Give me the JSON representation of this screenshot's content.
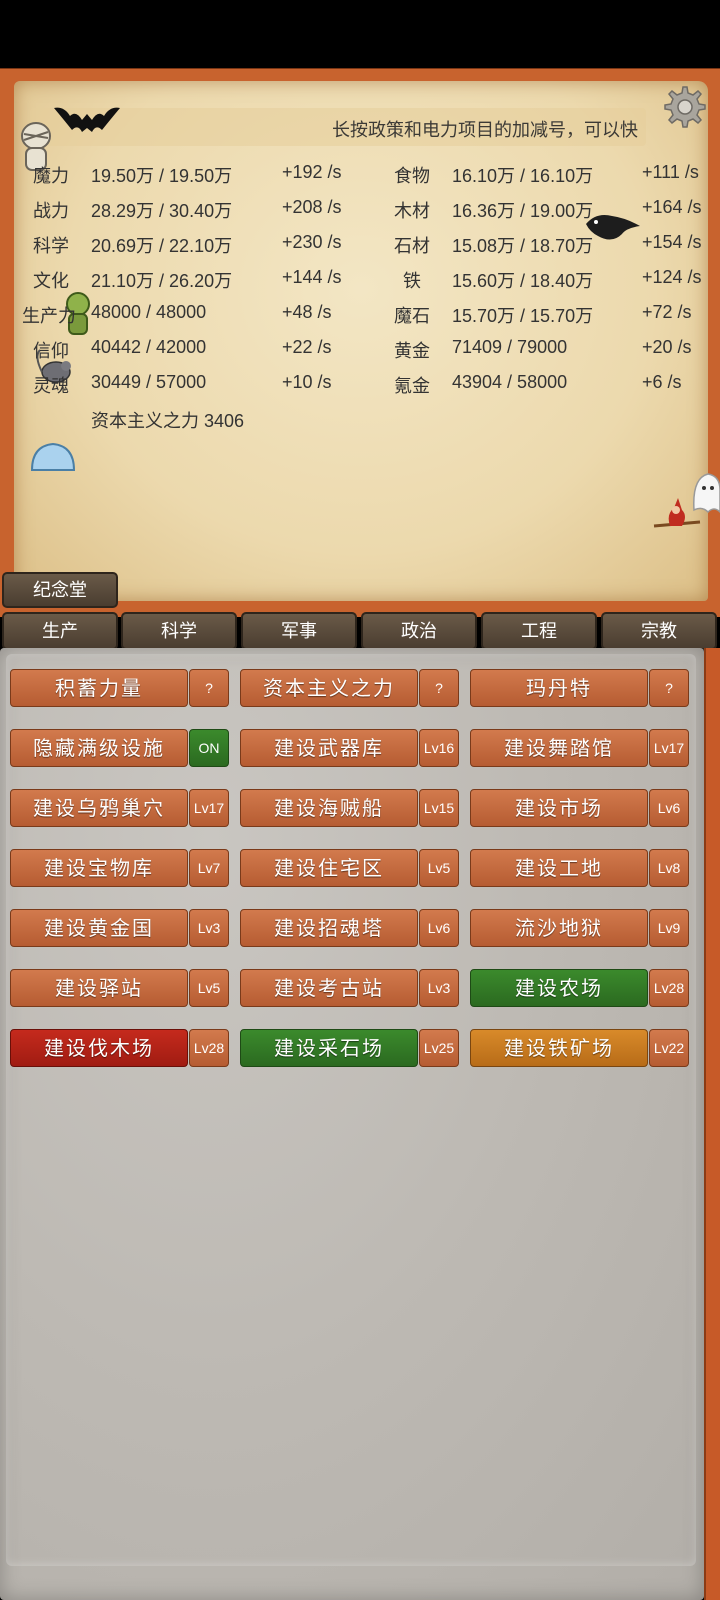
{
  "notice": "长按政策和电力项目的加减号，可以快",
  "stats_left": [
    {
      "name": "魔力",
      "value": "19.50万 / 19.50万",
      "rate": "+192 /s"
    },
    {
      "name": "战力",
      "value": "28.29万 / 30.40万",
      "rate": "+208 /s"
    },
    {
      "name": "科学",
      "value": "20.69万 / 22.10万",
      "rate": "+230 /s"
    },
    {
      "name": "文化",
      "value": "21.10万 / 26.20万",
      "rate": "+144 /s"
    },
    {
      "name": "生产力",
      "value": "48000 / 48000",
      "rate": "+48 /s"
    },
    {
      "name": "信仰",
      "value": "40442 / 42000",
      "rate": "+22 /s"
    },
    {
      "name": "灵魂",
      "value": "30449 / 57000",
      "rate": "+10 /s"
    }
  ],
  "stats_right": [
    {
      "name": "食物",
      "value": "16.10万 / 16.10万",
      "rate": "+111 /s"
    },
    {
      "name": "木材",
      "value": "16.36万 / 19.00万",
      "rate": "+164 /s"
    },
    {
      "name": "石材",
      "value": "15.08万 / 18.70万",
      "rate": "+154 /s"
    },
    {
      "name": "铁",
      "value": "15.60万 / 18.40万",
      "rate": "+124 /s"
    },
    {
      "name": "魔石",
      "value": "15.70万 / 15.70万",
      "rate": "+72 /s"
    },
    {
      "name": "黄金",
      "value": "71409 / 79000",
      "rate": "+20 /s"
    },
    {
      "name": "氪金",
      "value": "43904 / 58000",
      "rate": "+6 /s"
    }
  ],
  "capital": "资本主义之力 3406",
  "memorial": "纪念堂",
  "tabs": [
    "生产",
    "科学",
    "军事",
    "政治",
    "工程",
    "宗教"
  ],
  "buttons": [
    {
      "label": "积蓄力量",
      "tag": "?",
      "style": "normal",
      "tag_style": "normal"
    },
    {
      "label": "资本主义之力",
      "tag": "?",
      "style": "normal",
      "tag_style": "normal"
    },
    {
      "label": "玛丹特",
      "tag": "?",
      "style": "normal",
      "tag_style": "normal"
    },
    {
      "label": "隐藏满级设施",
      "tag": "ON",
      "style": "normal",
      "tag_style": "on"
    },
    {
      "label": "建设武器库",
      "tag": "Lv16",
      "style": "normal",
      "tag_style": "normal"
    },
    {
      "label": "建设舞踏馆",
      "tag": "Lv17",
      "style": "normal",
      "tag_style": "normal"
    },
    {
      "label": "建设乌鸦巢穴",
      "tag": "Lv17",
      "style": "normal",
      "tag_style": "normal"
    },
    {
      "label": "建设海贼船",
      "tag": "Lv15",
      "style": "normal",
      "tag_style": "normal"
    },
    {
      "label": "建设市场",
      "tag": "Lv6",
      "style": "normal",
      "tag_style": "normal"
    },
    {
      "label": "建设宝物库",
      "tag": "Lv7",
      "style": "normal",
      "tag_style": "normal"
    },
    {
      "label": "建设住宅区",
      "tag": "Lv5",
      "style": "normal",
      "tag_style": "normal"
    },
    {
      "label": "建设工地",
      "tag": "Lv8",
      "style": "normal",
      "tag_style": "normal"
    },
    {
      "label": "建设黄金国",
      "tag": "Lv3",
      "style": "normal",
      "tag_style": "normal"
    },
    {
      "label": "建设招魂塔",
      "tag": "Lv6",
      "style": "normal",
      "tag_style": "normal"
    },
    {
      "label": "流沙地狱",
      "tag": "Lv9",
      "style": "normal",
      "tag_style": "normal"
    },
    {
      "label": "建设驿站",
      "tag": "Lv5",
      "style": "normal",
      "tag_style": "normal"
    },
    {
      "label": "建设考古站",
      "tag": "Lv3",
      "style": "normal",
      "tag_style": "normal"
    },
    {
      "label": "建设农场",
      "tag": "Lv28",
      "style": "green",
      "tag_style": "normal"
    },
    {
      "label": "建设伐木场",
      "tag": "Lv28",
      "style": "red",
      "tag_style": "normal"
    },
    {
      "label": "建设采石场",
      "tag": "Lv25",
      "style": "green",
      "tag_style": "normal"
    },
    {
      "label": "建设铁矿场",
      "tag": "Lv22",
      "style": "orange",
      "tag_style": "normal"
    }
  ],
  "icons": [
    "gear-icon",
    "bat-icon",
    "mummy-sprite",
    "crow-sprite",
    "goblin-sprite",
    "rat-sprite",
    "slime-sprite",
    "ghost-sprite",
    "witch-sprite"
  ]
}
